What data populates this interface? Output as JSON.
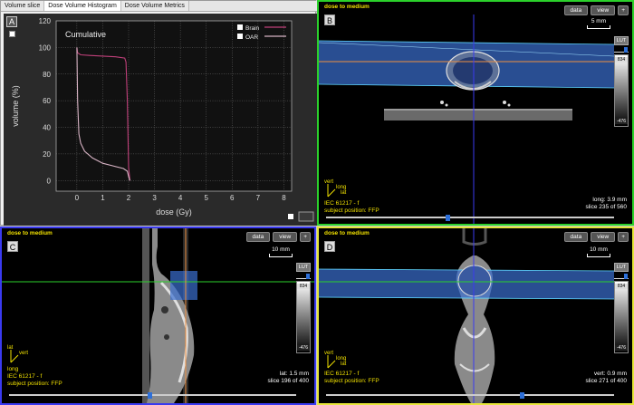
{
  "tabs": [
    "Volume slice",
    "Dose Volume Histogram",
    "Dose Volume Metrics"
  ],
  "active_tab": 1,
  "pane_labels": {
    "a": "A",
    "b": "B",
    "c": "C",
    "d": "D"
  },
  "dvh": {
    "title": "Cumulative",
    "legend": [
      "Brain",
      "OAR"
    ],
    "colors": {
      "brain": "#c0407a",
      "oar": "#d7b3c4",
      "grid": "#8a8a8a"
    }
  },
  "chart_data": {
    "type": "line",
    "title": "Cumulative",
    "xlabel": "dose (Gy)",
    "ylabel": "volume (%)",
    "xlim": [
      -0.8,
      8.3
    ],
    "ylim": [
      -8,
      120
    ],
    "xticks": [
      0,
      1,
      2,
      3,
      4,
      5,
      6,
      7,
      8
    ],
    "yticks": [
      0,
      20,
      40,
      60,
      80,
      100,
      120
    ],
    "grid": true,
    "legend_position": "top-right",
    "series": [
      {
        "name": "Brain",
        "x": [
          0,
          0.03,
          0.15,
          0.5,
          1.0,
          1.5,
          1.85,
          1.9,
          1.95,
          2.0,
          2.05
        ],
        "y": [
          100,
          96,
          94.5,
          94,
          93.5,
          93,
          92,
          89,
          60,
          10,
          0
        ]
      },
      {
        "name": "OAR",
        "x": [
          0,
          0.03,
          0.08,
          0.15,
          0.3,
          0.6,
          1.0,
          1.4,
          1.8,
          1.95,
          2.0,
          2.05
        ],
        "y": [
          100,
          60,
          35,
          28,
          22,
          17,
          13,
          11,
          9,
          7,
          3,
          0
        ]
      }
    ]
  },
  "views": {
    "b": {
      "title": "dose to medium",
      "buttons": {
        "data": "data",
        "view": "view",
        "plus": "+"
      },
      "scale": "5 mm",
      "lut": "LUT",
      "lut_max": "834",
      "lut_min": "-476",
      "axes": {
        "up": "vert",
        "right": "lat",
        "diag": "long"
      },
      "info_left": [
        "IEC 61217 - f",
        "subject position: FFP"
      ],
      "info_right": [
        "long: 3.9 mm",
        "slice 235 of 560"
      ],
      "slider_fraction": 0.42
    },
    "c": {
      "title": "dose to medium",
      "buttons": {
        "data": "data",
        "view": "view",
        "plus": "+"
      },
      "scale": "10 mm",
      "lut": "LUT",
      "lut_max": "834",
      "lut_min": "-476",
      "axes": {
        "up": "lat",
        "right": "vert",
        "diag": "long"
      },
      "info_left": [
        "IEC 61217 - f",
        "subject position: FFP"
      ],
      "info_right": [
        "lat: 1.5 mm",
        "slice 196 of 400"
      ],
      "slider_fraction": 0.49
    },
    "d": {
      "title": "dose to medium",
      "buttons": {
        "data": "data",
        "view": "view",
        "plus": "+"
      },
      "scale": "10 mm",
      "lut": "LUT",
      "lut_max": "834",
      "lut_min": "-476",
      "axes": {
        "up": "vert",
        "right": "lat",
        "diag": "long"
      },
      "info_left": [
        "IEC 61217 - f",
        "subject position: FFP"
      ],
      "info_right": [
        "vert: 0.9 mm",
        "slice 271 of 400"
      ],
      "slider_fraction": 0.68
    }
  }
}
